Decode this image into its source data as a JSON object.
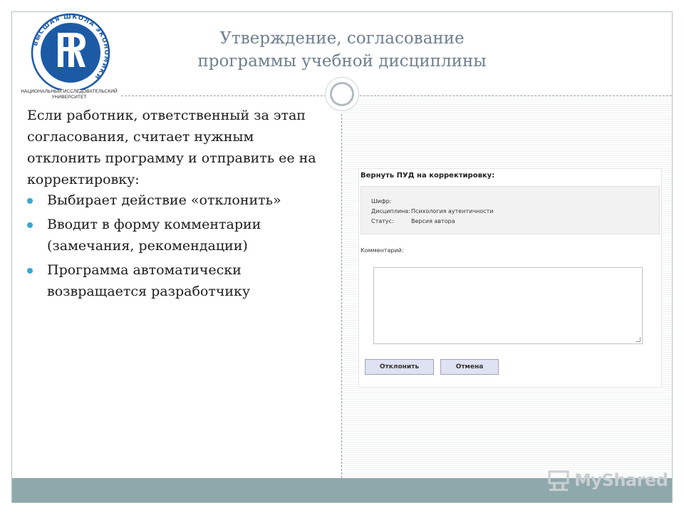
{
  "slide": {
    "title_line1": "Утверждение, согласование",
    "title_line2": "программы учебной дисциплины",
    "intro": "Если работник, ответственный за этап согласования, считает нужным отклонить программу и отправить ее на корректировку:",
    "bullets": [
      "Выбирает действие «отклонить»",
      "Вводит в форму комментарии (замечания, рекомендации)",
      "Программа автоматически возвращается разработчику"
    ]
  },
  "logo": {
    "ring_text": "ВЫСШАЯ ШКОЛА ЭКОНОМИКИ",
    "caption_line1": "НАЦИОНАЛЬНЫЙ ИССЛЕДОВАТЕЛЬСКИЙ",
    "caption_line2": "УНИВЕРСИТЕТ",
    "color": "#1d5aa6"
  },
  "form": {
    "title": "Вернуть ПУД на корректировку:",
    "fields": [
      {
        "label": "Шифр:",
        "value": ""
      },
      {
        "label": "Дисциплина:",
        "value": "Психология аутентичности"
      },
      {
        "label": "Статус:",
        "value": "Версия автора"
      }
    ],
    "comment_label": "Комментарий:",
    "comment_value": "",
    "reject_button": "Отклонить",
    "cancel_button": "Отмена"
  },
  "watermark": {
    "text": "MyShared"
  },
  "colors": {
    "accent": "#3aa6d6",
    "title": "#6f7f8e",
    "footer": "#8fa8ab"
  }
}
